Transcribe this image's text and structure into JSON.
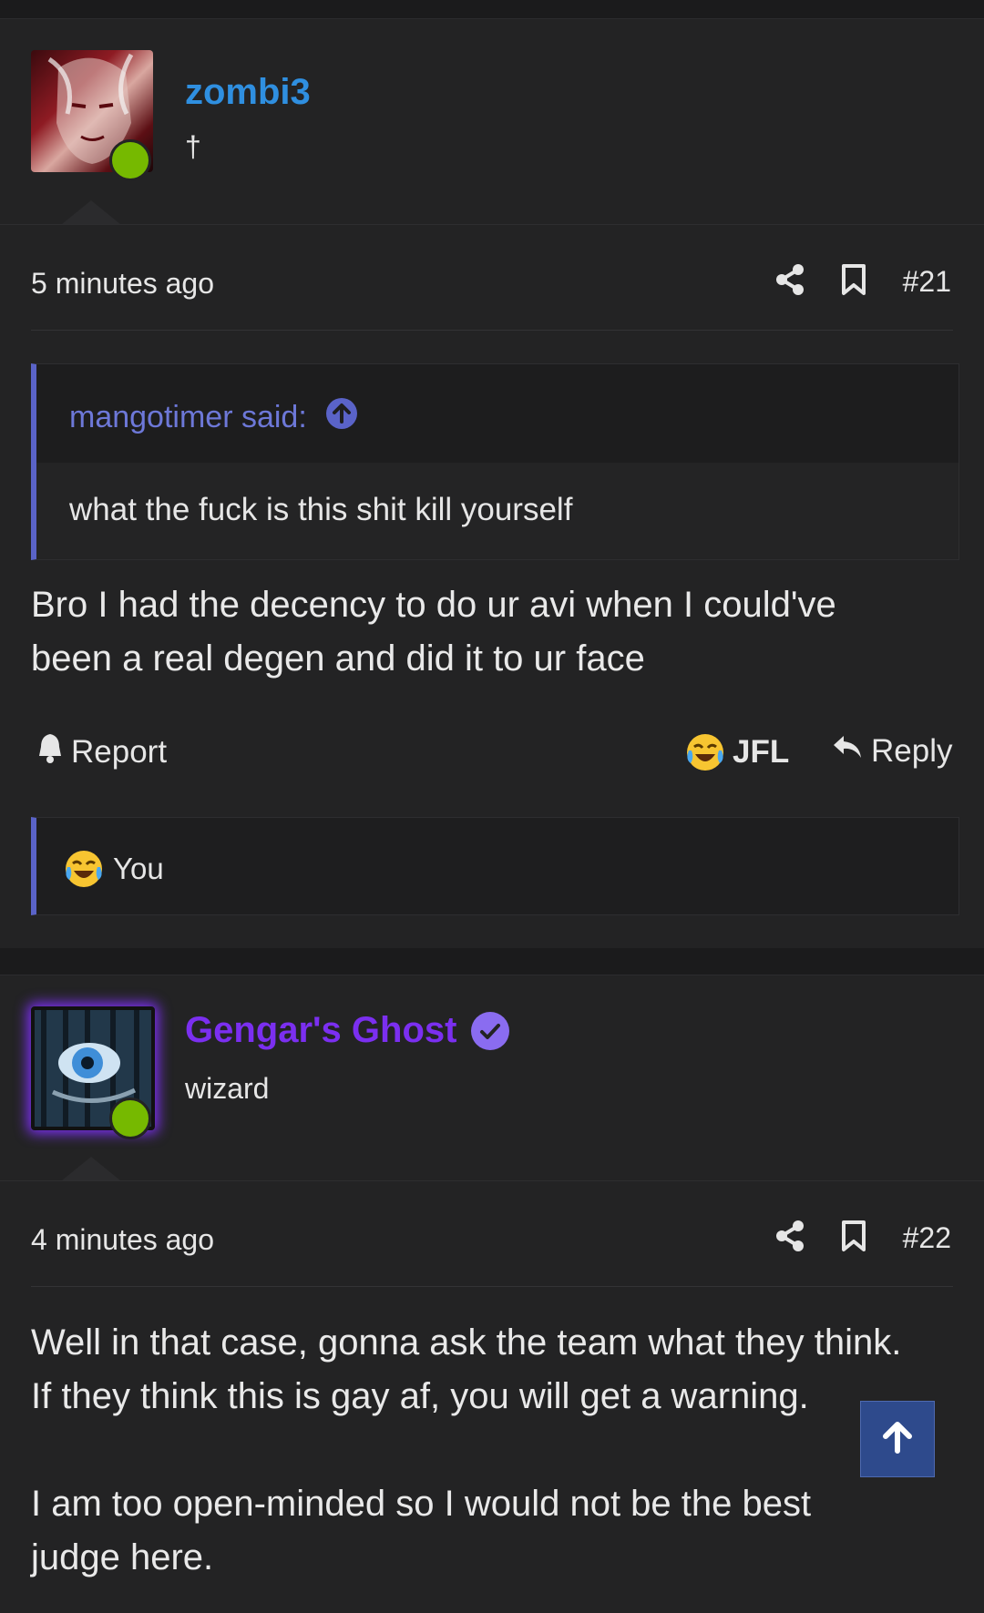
{
  "posts": [
    {
      "username": "zombi3",
      "user_title": "†",
      "time": "5 minutes ago",
      "number": "#21",
      "quote": {
        "author": "mangotimer said:",
        "text": "what the fuck is this shit kill yourself"
      },
      "message_lines": [
        "Bro I had the decency to do ur avi when I could've",
        "been a real degen and did it to ur face"
      ],
      "actions": {
        "report": "Report",
        "reaction": "JFL",
        "reply": "Reply"
      },
      "reactions_by": "You"
    },
    {
      "username": "Gengar's Ghost",
      "user_title": "wizard",
      "time": "4 minutes ago",
      "number": "#22",
      "message_lines": [
        "Well in that case, gonna ask the team what they think.",
        "If they think this is gay af, you will get a warning.",
        "",
        "I am too open-minded so I would not be the best",
        "judge here."
      ]
    }
  ],
  "colors": {
    "username_blue": "#2f8fe0",
    "username_purple": "#7b2ff0",
    "online": "#76b900",
    "quote_accent": "#5a63c8",
    "scroll_button": "#2e4a8c"
  },
  "icons": [
    "share-icon",
    "bookmark-icon",
    "bell-icon",
    "reply-icon",
    "arrow-up-icon",
    "verified-badge-icon",
    "laughing-crying-emoji"
  ]
}
